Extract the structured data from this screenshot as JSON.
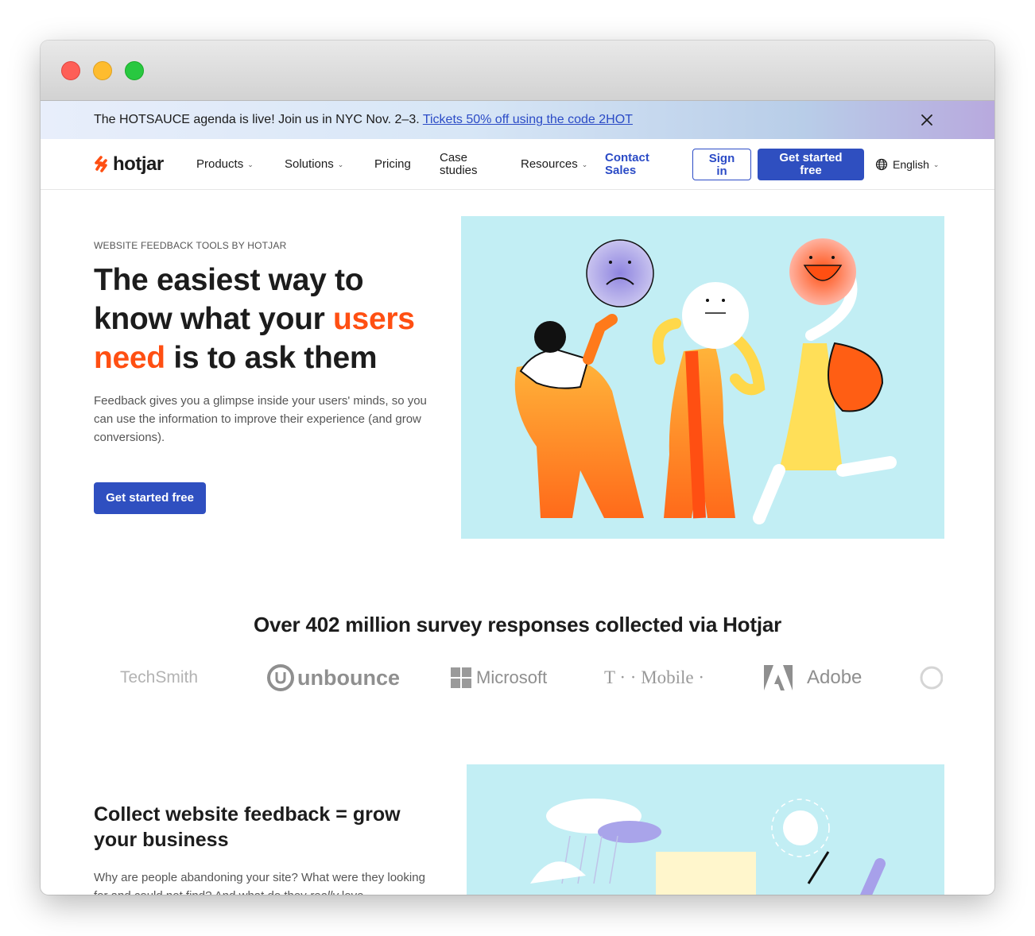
{
  "banner": {
    "text": "The HOTSAUCE agenda is live! Join us in NYC Nov. 2–3.",
    "link": "Tickets 50% off using the code 2HOT"
  },
  "nav": {
    "logo": "hotjar",
    "products": "Products",
    "solutions": "Solutions",
    "pricing": "Pricing",
    "case_studies_1": "Case",
    "case_studies_2": "studies",
    "resources": "Resources",
    "contact_1": "Contact",
    "contact_2": "Sales",
    "signin_1": "Sign",
    "signin_2": "in",
    "get_started_1": "Get started",
    "get_started_2": "free",
    "language": "English"
  },
  "hero": {
    "eyebrow": "WEBSITE FEEDBACK TOOLS BY HOTJAR",
    "headline_1": "The easiest way to know what your ",
    "headline_accent": "users need",
    "headline_2": " is to ask them",
    "subtitle": "Feedback gives you a glimpse inside your users' minds, so you can use the information to improve their experience (and grow conversions).",
    "cta": "Get started free"
  },
  "stats": {
    "title": "Over 402 million survey responses collected via Hotjar"
  },
  "logos": [
    "TechSmith",
    "unbounce",
    "Microsoft",
    "T · · Mobile ·",
    "Adobe"
  ],
  "section2": {
    "title": "Collect website feedback = grow your business",
    "subtitle_1": "Why are people abandoning your site? What were they looking for and could not find? And what do they ",
    "subtitle_em": "really",
    "subtitle_2": " love"
  },
  "colors": {
    "accent": "#ff4f12",
    "brand_blue": "#2f4fc0",
    "illustration_bg": "#c2eef4"
  }
}
